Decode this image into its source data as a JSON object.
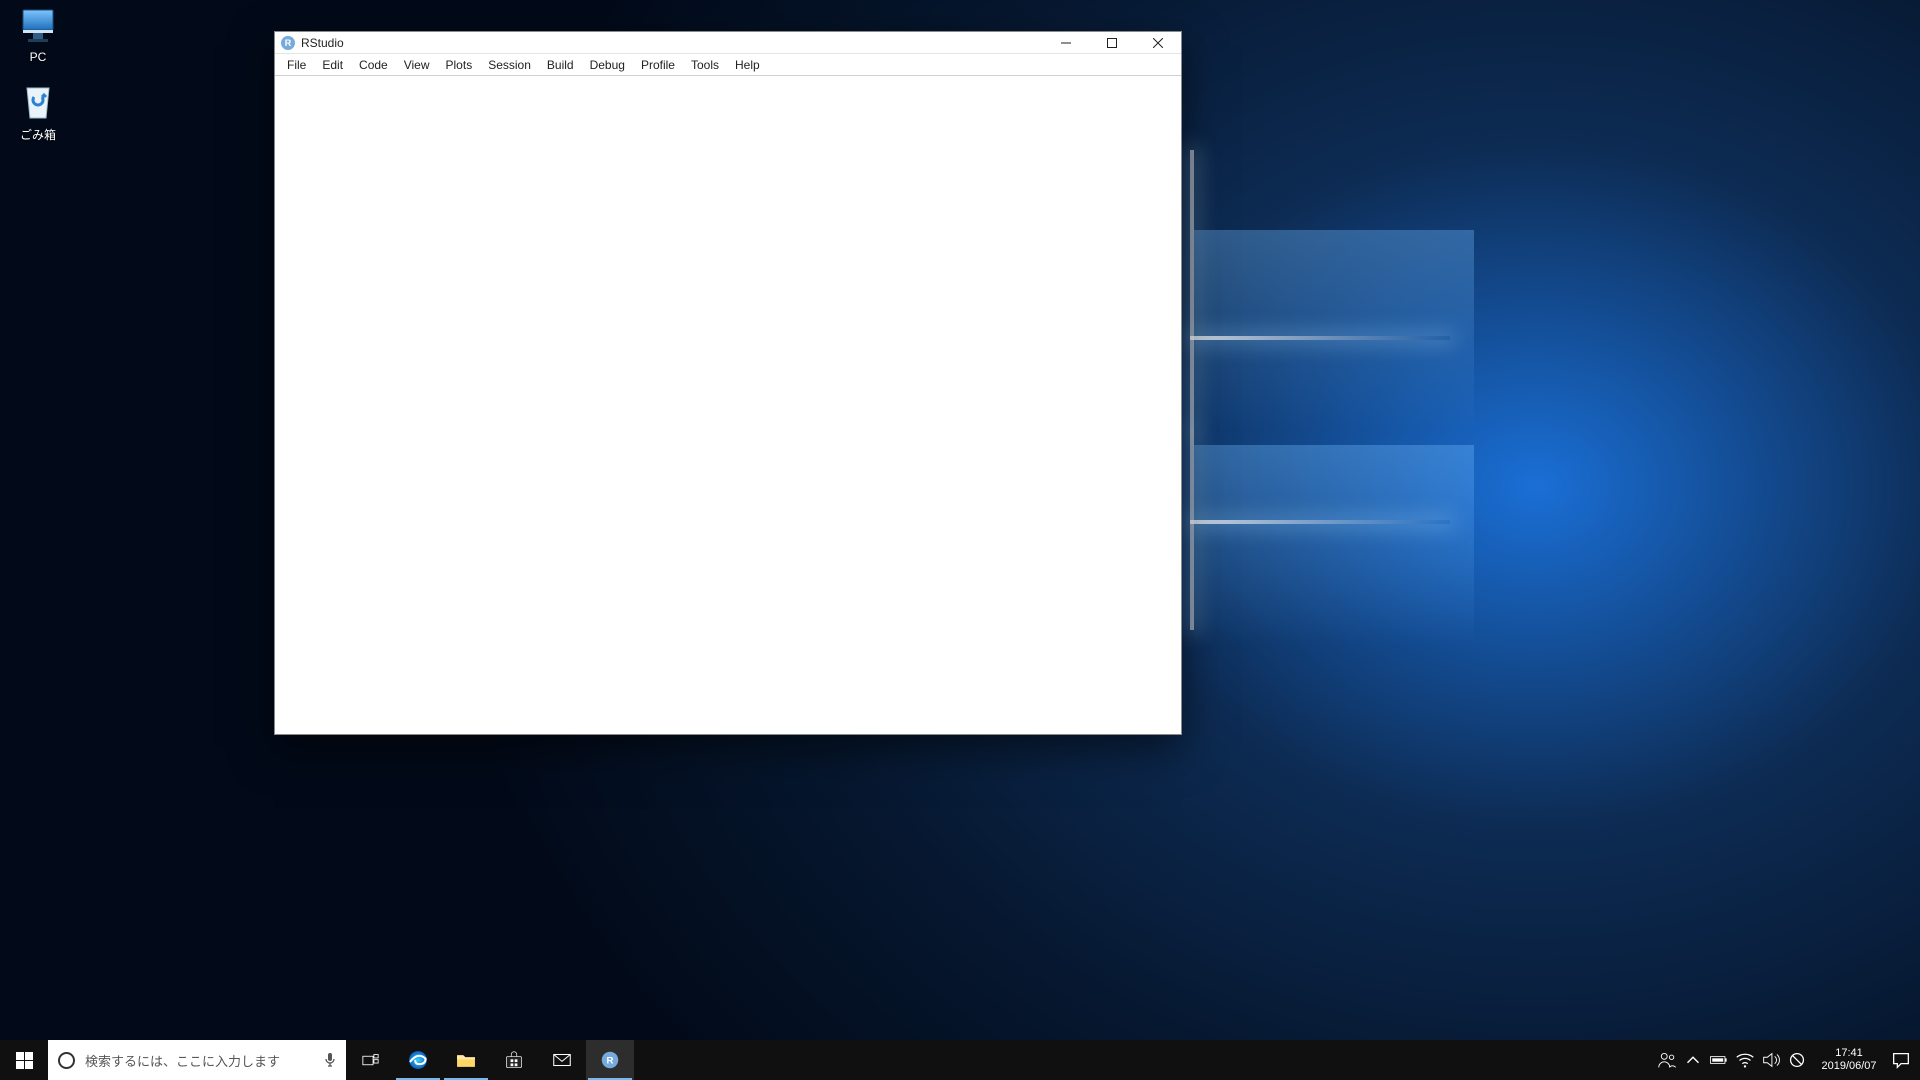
{
  "desktop_icons": {
    "pc_label": "PC",
    "recycle_label": "ごみ箱"
  },
  "window": {
    "title": "RStudio",
    "app_initial": "R",
    "menu": [
      "File",
      "Edit",
      "Code",
      "View",
      "Plots",
      "Session",
      "Build",
      "Debug",
      "Profile",
      "Tools",
      "Help"
    ]
  },
  "taskbar": {
    "search_placeholder": "検索するには、ここに入力します",
    "time": "17:41",
    "date": "2019/06/07"
  }
}
